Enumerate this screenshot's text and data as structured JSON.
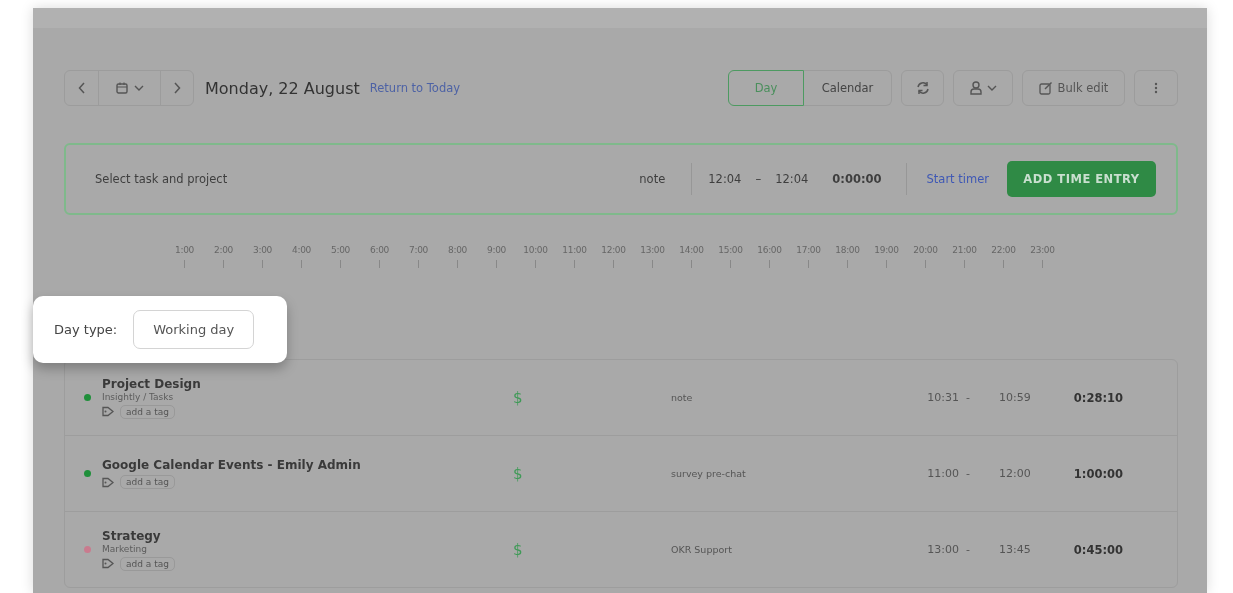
{
  "toolbar": {
    "date_label": "Monday, 22 August",
    "return_link": "Return to Today",
    "views": [
      {
        "label": "Day",
        "selected": true
      },
      {
        "label": "Calendar",
        "selected": false
      }
    ],
    "bulk_edit": "Bulk edit"
  },
  "timer": {
    "placeholder": "Select task and project",
    "note": "note",
    "start": "12:04",
    "separator": "–",
    "end": "12:04",
    "duration": "0:00:00",
    "start_timer": "Start timer",
    "add_button": "ADD TIME ENTRY"
  },
  "timeline": {
    "hours": [
      "1:00",
      "2:00",
      "3:00",
      "4:00",
      "5:00",
      "6:00",
      "7:00",
      "8:00",
      "9:00",
      "10:00",
      "11:00",
      "12:00",
      "13:00",
      "14:00",
      "15:00",
      "16:00",
      "17:00",
      "18:00",
      "19:00",
      "20:00",
      "21:00",
      "22:00",
      "23:00"
    ]
  },
  "day_type": {
    "label": "Day type:",
    "value": "Working day"
  },
  "entries": [
    {
      "name": "Project Design",
      "project": "Insightly / Tasks",
      "color": "#1f8f3a",
      "tag_placeholder": "add a tag",
      "billable": true,
      "currency": "$",
      "note": "note",
      "start": "10:31",
      "separator": "-",
      "end": "10:59",
      "duration": "0:28:10"
    },
    {
      "name": "Google Calendar Events - Emily Admin",
      "color": "#1f8f3a",
      "tag_placeholder": "add a tag",
      "billable": true,
      "currency": "$",
      "note": "survey pre-chat",
      "start": "11:00",
      "separator": "-",
      "end": "12:00",
      "duration": "1:00:00"
    },
    {
      "name": "Strategy",
      "project": "Marketing",
      "color": "#c97b8e",
      "tag_placeholder": "add a tag",
      "billable": true,
      "currency": "$",
      "note": "OKR Support",
      "start": "13:00",
      "separator": "-",
      "end": "13:45",
      "duration": "0:45:00"
    }
  ]
}
